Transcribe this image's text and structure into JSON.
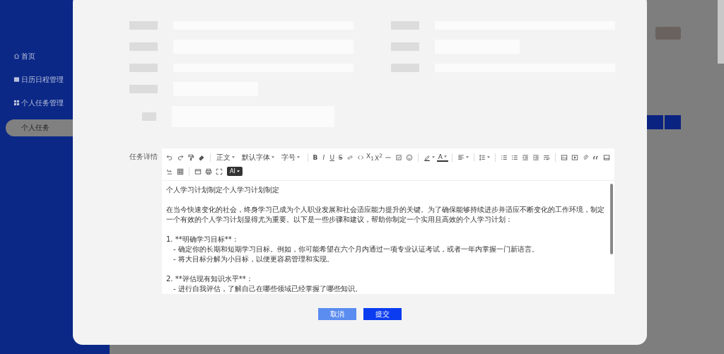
{
  "sidebar": {
    "items": [
      {
        "label": "首页",
        "selected": false
      },
      {
        "label": "日历日程管理",
        "selected": false
      },
      {
        "label": "个人任务管理",
        "selected": false,
        "children": [
          {
            "label": "个人任务",
            "selected": true
          }
        ]
      }
    ]
  },
  "dialog": {
    "detail_label": "任务详情",
    "toolbar": {
      "rows": [
        [
          {
            "kind": "icon"
          },
          {
            "kind": "icon"
          },
          {
            "kind": "icon"
          },
          {
            "kind": "icon"
          },
          {
            "kind": "sep"
          },
          {
            "kind": "dropdown",
            "label": "正文"
          },
          {
            "kind": "dropdown",
            "label": "默认字体"
          },
          {
            "kind": "dropdown",
            "label": "字号"
          },
          {
            "kind": "sep"
          },
          {
            "kind": "bold",
            "label": "B"
          },
          {
            "kind": "italic",
            "label": "I"
          },
          {
            "kind": "underline",
            "label": "U"
          },
          {
            "kind": "strike",
            "label": "S"
          },
          {
            "kind": "icon"
          },
          {
            "kind": "icon"
          },
          {
            "kind": "script",
            "label": "X$_{1}$"
          },
          {
            "kind": "script",
            "label": "X$^{2}$"
          },
          {
            "kind": "icon"
          },
          {
            "kind": "icon"
          },
          {
            "kind": "icon"
          },
          {
            "kind": "sep"
          },
          {
            "kind": "icon-menu"
          },
          {
            "kind": "color",
            "label": "A"
          },
          {
            "kind": "sep"
          },
          {
            "kind": "icon-menu"
          },
          {
            "kind": "sep"
          },
          {
            "kind": "icon-menu"
          },
          {
            "kind": "sep"
          },
          {
            "kind": "icon"
          },
          {
            "kind": "icon"
          },
          {
            "kind": "icon"
          },
          {
            "kind": "icon"
          },
          {
            "kind": "icon"
          },
          {
            "kind": "sep"
          },
          {
            "kind": "icon"
          },
          {
            "kind": "icon"
          },
          {
            "kind": "icon"
          },
          {
            "kind": "icon"
          },
          {
            "kind": "icon"
          }
        ],
        [
          {
            "kind": "icon"
          },
          {
            "kind": "icon"
          },
          {
            "kind": "sep"
          },
          {
            "kind": "icon"
          },
          {
            "kind": "icon"
          },
          {
            "kind": "icon"
          },
          {
            "kind": "ai",
            "label": "AI"
          }
        ]
      ]
    },
    "content": [
      {
        "text": "个人学习计划制定个人学习计划制定"
      },
      {
        "text": "在当今快速变化的社会，终身学习已成为个人职业发展和社会适应能力提升的关键。为了确保能够持续进步并适应不断变化的工作环境，制定一个有效的个人学习计划显得尤为重要。以下是一些步骤和建议，帮助你制定一个实用且高效的个人学习计划："
      },
      {
        "text": "1. **明确学习目标**：",
        "children": [
          "- 确定你的长期和短期学习目标。例如，你可能希望在六个月内通过一项专业认证考试，或者一年内掌握一门新语言。",
          "- 将大目标分解为小目标，以便更容易管理和实现。"
        ]
      },
      {
        "text": "2. **评估现有知识水平**：",
        "children": [
          "- 进行自我评估，了解自己在哪些领域已经掌握了哪些知识。"
        ]
      }
    ],
    "buttons": [
      {
        "label": "取消",
        "kind": "secondary"
      },
      {
        "label": "提交",
        "kind": "primary"
      }
    ]
  }
}
